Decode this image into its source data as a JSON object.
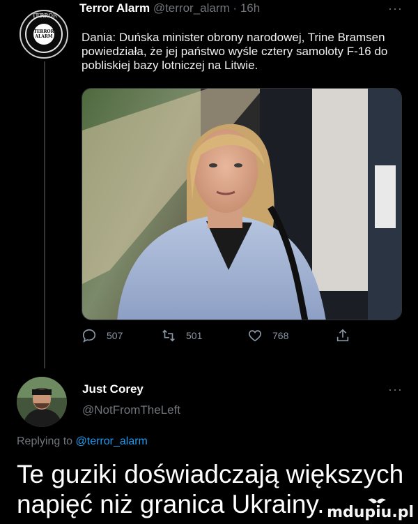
{
  "tweet": {
    "author": {
      "name": "Terror Alarm",
      "handle": "@terror_alarm",
      "time": "16h",
      "avatar_icon": "terror-alarm-seal-icon",
      "avatar_text_top": "TERROR",
      "avatar_text_core": "TERROR ALARM"
    },
    "separator": "·",
    "more_label": "···",
    "text": "Dania: Duńska minister obrony narodowej, Trine Bramsen powiedziała, że jej państwo wyśle cztery samoloty F-16 do pobliskiej bazy lotniczej na Litwie.",
    "actions": {
      "reply_count": "507",
      "retweet_count": "501",
      "like_count": "768"
    }
  },
  "reply": {
    "name": "Just Corey",
    "handle": "@NotFromTheLeft",
    "more_label": "···",
    "replying_prefix": "Replying to",
    "replying_to": "@terror_alarm"
  },
  "caption": "Te guziki doświadczają większych napięć niż granica Ukrainy.",
  "watermark": "mdupiu.pl",
  "colors": {
    "background": "#000000",
    "muted": "#71767b",
    "link": "#1d9bf0",
    "text": "#e7e9ea"
  }
}
